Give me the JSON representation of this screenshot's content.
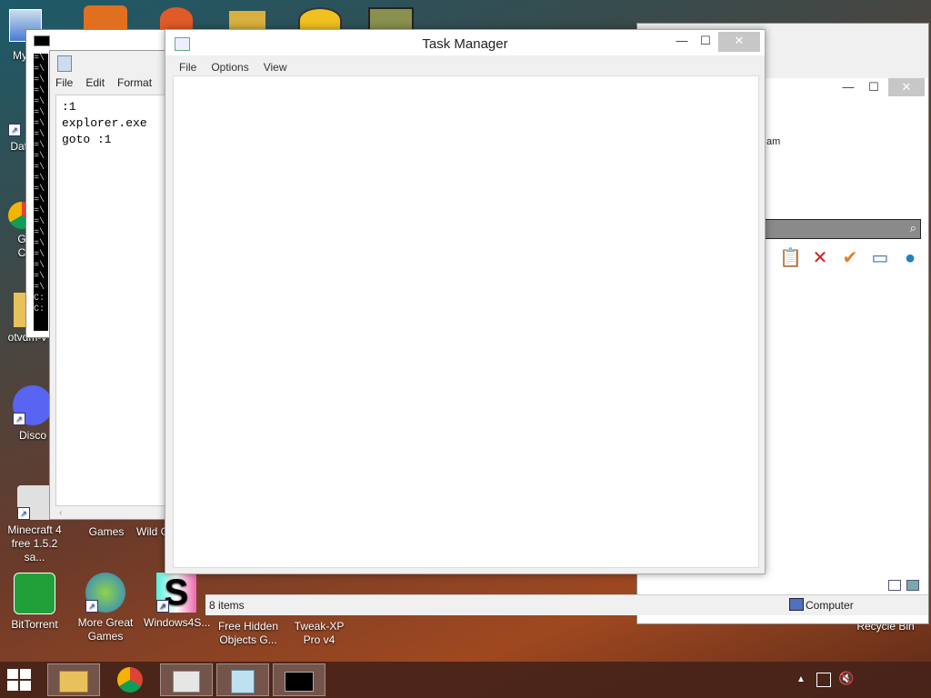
{
  "desktop": {
    "icons": [
      {
        "label": "My C",
        "icon": "computer-icon"
      },
      {
        "label": "Data",
        "icon": "database-icon"
      },
      {
        "label": "G\nC",
        "icon": "chrome-icon"
      },
      {
        "label": "otvdm-v",
        "icon": "folder-icon"
      },
      {
        "label": "Disco",
        "icon": "discord-icon"
      },
      {
        "label": "Minecraft 4 free 1.5.2 sa...",
        "icon": "installer-icon"
      },
      {
        "label": "Games",
        "icon": "games-icon"
      },
      {
        "label": "Wild G",
        "icon": "game-icon"
      },
      {
        "label": "BitTorrent",
        "icon": "bittorrent-icon"
      },
      {
        "label": "More Great Games",
        "icon": "games-icon"
      },
      {
        "label": "Windows4S...",
        "icon": "s-logo-icon"
      },
      {
        "label": "Free Hidden Objects G...",
        "icon": "game-icon"
      },
      {
        "label": "Tweak-XP Pro v4",
        "icon": "tweak-icon"
      },
      {
        "label": "Recycle Bin",
        "icon": "recycle-bin-icon"
      }
    ]
  },
  "task_manager": {
    "title": "Task Manager",
    "menu": [
      "File",
      "Options",
      "View"
    ]
  },
  "notepad": {
    "menu": [
      "File",
      "Edit",
      "Format"
    ],
    "content": ":1\nexplorer.exe\ngoto :1"
  },
  "cmd": {
    "lines": [
      "=\\",
      "=\\",
      "=\\",
      "=\\",
      "=\\",
      "=\\",
      "=\\",
      "=\\",
      "=\\",
      "=\\",
      "=\\",
      "=\\",
      "=\\",
      "=\\",
      "=\\",
      "=\\",
      "=\\",
      "=\\",
      "=\\",
      "=\\",
      "=\\",
      "=\\",
      "C:",
      "C:"
    ]
  },
  "explorer": {
    "partial_text": "am",
    "status_items": "8 items",
    "status_location": "Computer"
  },
  "colors": {
    "taskbar": "#46231a",
    "accent_red": "#e81123"
  }
}
